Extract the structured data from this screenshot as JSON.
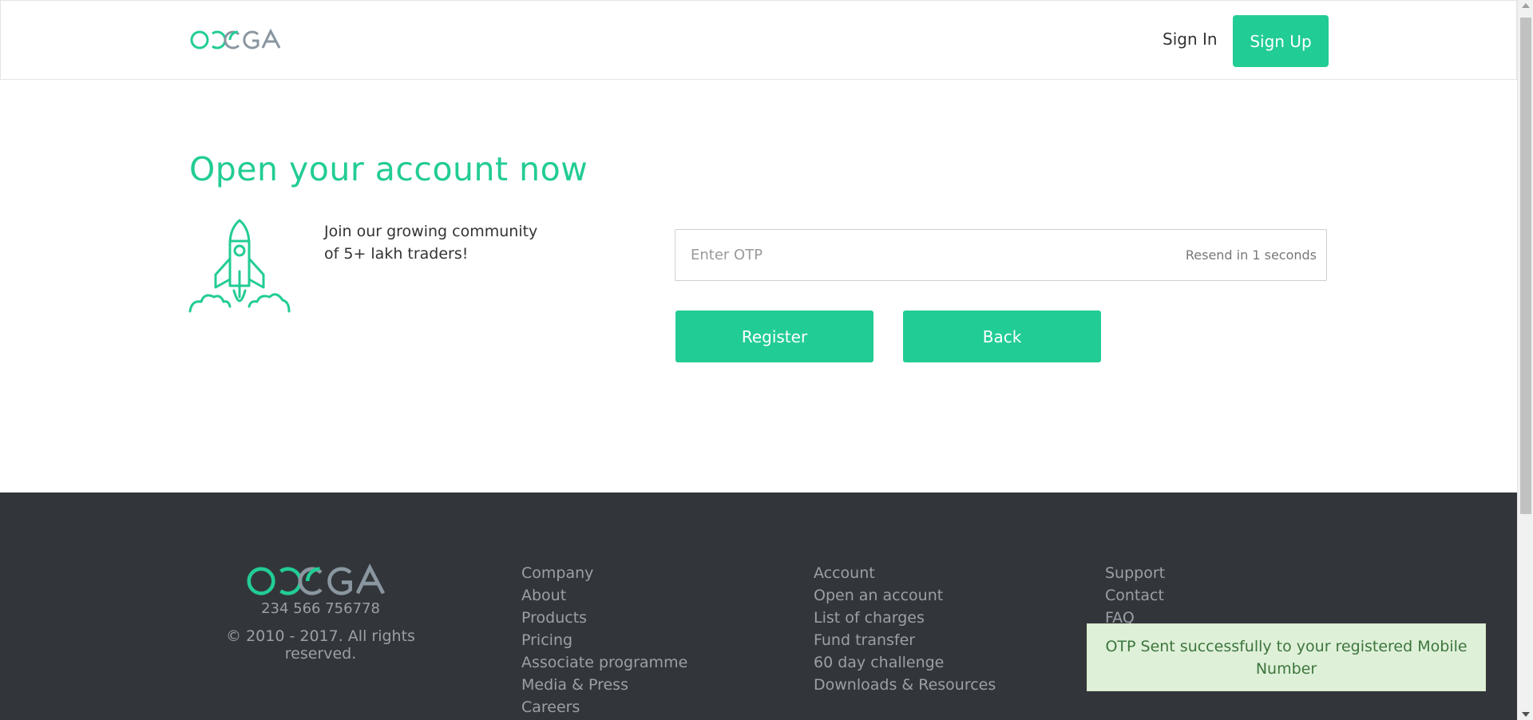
{
  "brand": {
    "logo_text": "OMEGA",
    "accent_color": "#22cc95",
    "logo_gray": "#8a96a0"
  },
  "nav": {
    "signin_label": "Sign In",
    "signup_label": "Sign Up"
  },
  "hero": {
    "title": "Open your account now",
    "icon": "rocket-icon",
    "community_line1": "Join our growing community",
    "community_line2": "of 5+ lakh traders!"
  },
  "form": {
    "otp_placeholder": "Enter OTP",
    "otp_value": "",
    "resend_text": "Resend in 1 seconds",
    "register_label": "Register",
    "back_label": "Back"
  },
  "footer": {
    "background": "#32363a",
    "phone": "234 566 756778",
    "copyright": "© 2010 - 2017. All rights reserved.",
    "columns": [
      [
        "Company",
        "About",
        "Products",
        "Pricing",
        "Associate programme",
        "Media & Press",
        "Careers"
      ],
      [
        "Account",
        "Open an account",
        "List of charges",
        "Fund transfer",
        "60 day challenge",
        "Downloads & Resources"
      ],
      [
        "Support",
        "Contact",
        "FAQ"
      ]
    ]
  },
  "toast": {
    "message": "OTP Sent successfully to your registered Mobile Number",
    "background": "#dff0d8"
  }
}
